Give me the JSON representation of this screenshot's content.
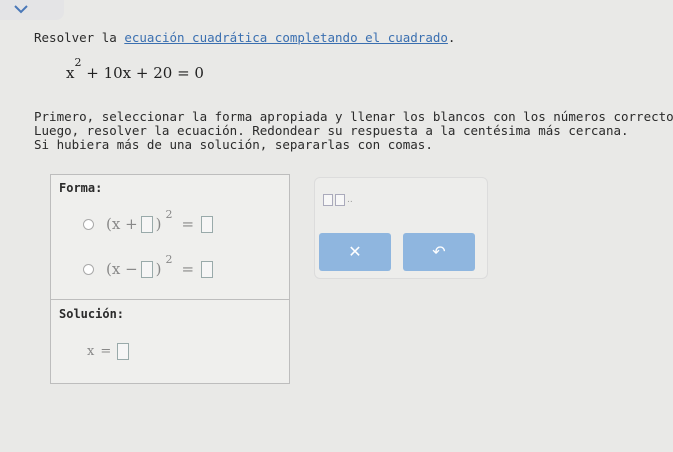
{
  "header": {
    "collapse_icon": "chevron-down-icon",
    "accent": "#4a78b8"
  },
  "instructions": {
    "prefix": "Resolver la ",
    "link_text": "ecuación cuadrática completando el cuadrado",
    "suffix": "."
  },
  "equation": {
    "base": "x",
    "exp": "2",
    "rest": " + 10x + 20 = 0"
  },
  "paragraph": [
    "Primero, seleccionar la forma apropiada y llenar los blancos con los números correctos.",
    "Luego, resolver la ecuación. Redondear su respuesta a la centésima más cercana.",
    "Si hubiera más de una solución, separarlas con comas."
  ],
  "form": {
    "label": "Forma:",
    "option1": {
      "left": "(x +",
      "right": ")",
      "exp": "2",
      "equals": "="
    },
    "option2": {
      "left": "(x −",
      "right": ")",
      "exp": "2",
      "equals": "="
    }
  },
  "solution": {
    "label": "Solución:",
    "var": "x",
    "equals": "="
  },
  "answer_panel": {
    "template_icon": "two-box-template-icon",
    "clear_symbol": "✕",
    "undo_symbol": "↶",
    "button_color": "#8fb6df"
  }
}
